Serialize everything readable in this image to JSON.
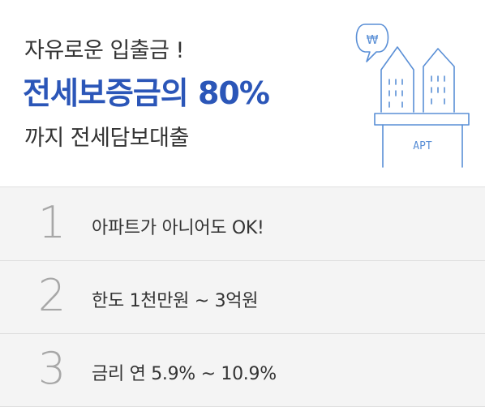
{
  "headline": {
    "line1": "자유로운 입출금 !",
    "line2": "전세보증금의 80%",
    "line3": "까지 전세담보대출"
  },
  "illustration": {
    "bubble_symbol": "₩",
    "sign_text": "APT",
    "icon": "apartment-building-icon",
    "stroke_color": "#5a8fd6"
  },
  "features": [
    {
      "number": "1",
      "text": "아파트가 아니어도 OK!"
    },
    {
      "number": "2",
      "text": "한도 1천만원 ~ 3억원"
    },
    {
      "number": "3",
      "text": "금리 연 5.9% ~ 10.9%"
    }
  ],
  "colors": {
    "accent": "#2b56b8",
    "list_bg": "#f4f4f4"
  }
}
